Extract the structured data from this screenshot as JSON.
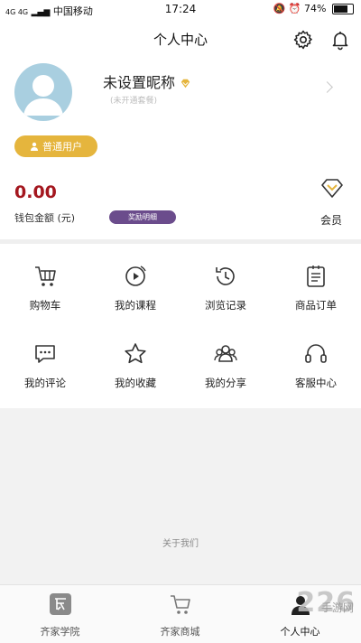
{
  "status_bar": {
    "network": "4G 4G",
    "carrier": "中国移动",
    "time": "17:24",
    "battery": "74%",
    "battery_level": 0.74
  },
  "header": {
    "title": "个人中心"
  },
  "profile": {
    "nickname": "未设置昵称",
    "subtitle": "(未开通套餐)",
    "user_type": "普通用户"
  },
  "wallet": {
    "amount": "0.00",
    "label": "钱包金额 (元)",
    "reward_button": "奖励明细"
  },
  "vip": {
    "label": "会员"
  },
  "menu": [
    {
      "label": "购物车",
      "icon": "cart-icon"
    },
    {
      "label": "我的课程",
      "icon": "play-icon"
    },
    {
      "label": "浏览记录",
      "icon": "history-icon"
    },
    {
      "label": "商品订单",
      "icon": "order-icon"
    },
    {
      "label": "我的评论",
      "icon": "comment-icon"
    },
    {
      "label": "我的收藏",
      "icon": "star-icon"
    },
    {
      "label": "我的分享",
      "icon": "share-icon"
    },
    {
      "label": "客服中心",
      "icon": "headset-icon"
    }
  ],
  "about": "关于我们",
  "tabs": [
    {
      "label": "齐家学院",
      "icon": "academy-icon"
    },
    {
      "label": "齐家商城",
      "icon": "shop-icon"
    },
    {
      "label": "个人中心",
      "icon": "profile-icon"
    }
  ],
  "watermark": {
    "big": "226",
    "small": "手游网"
  },
  "colors": {
    "accent": "#e5b53d",
    "amount": "#a4171f",
    "reward": "#6b4c8c"
  }
}
